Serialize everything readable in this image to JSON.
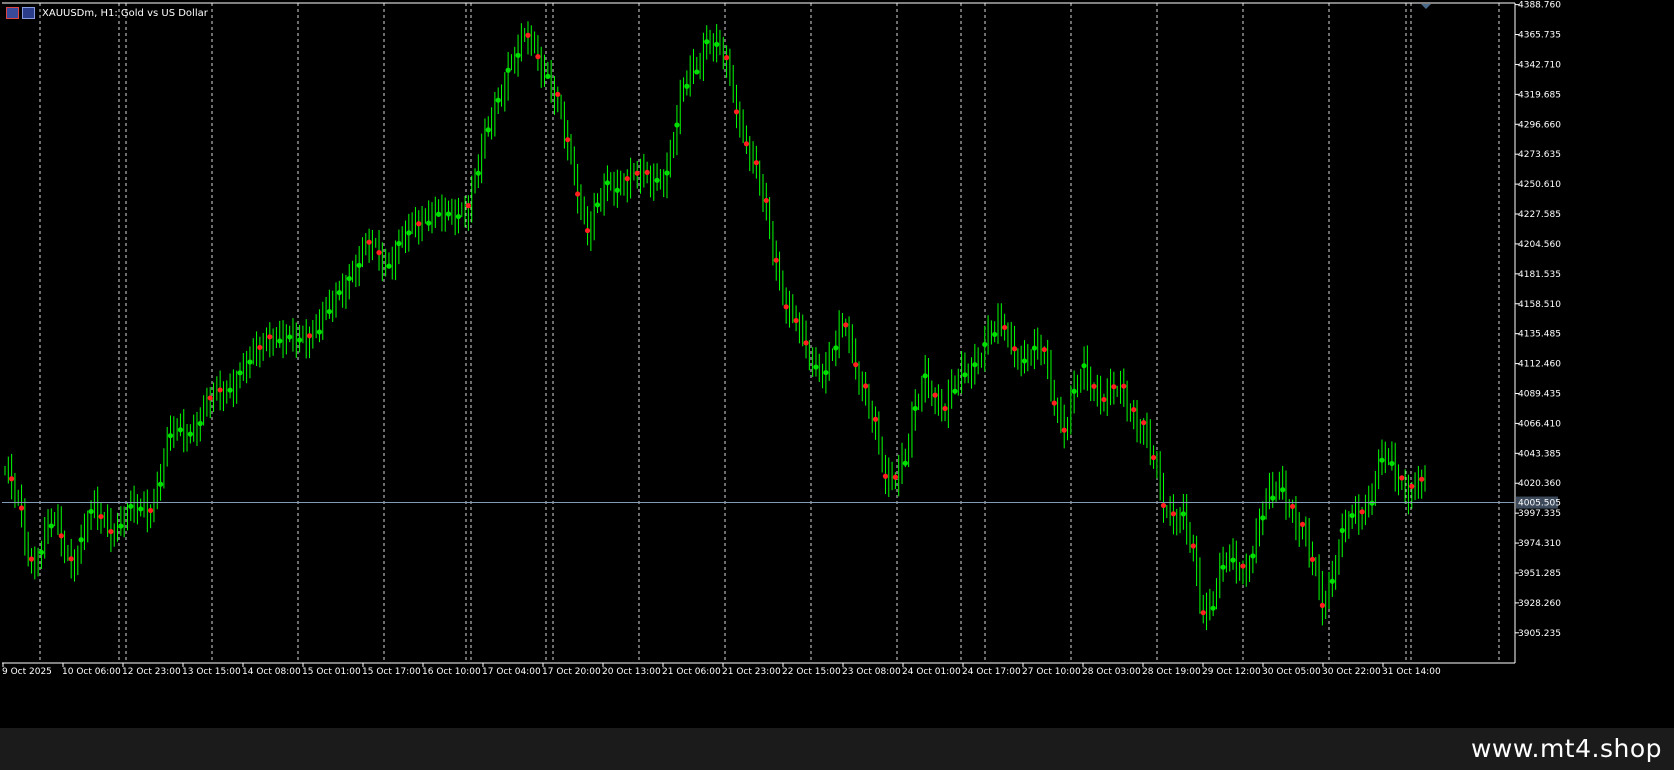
{
  "header": {
    "symbol_title": "XAUUSDm, H1:  Gold vs US Dollar"
  },
  "watermark": "www.mt4.shop",
  "current_price": {
    "label": "4005.505",
    "value": 4005.505
  },
  "colors": {
    "background": "#000000",
    "up_candle": "#00ff00",
    "up_dot": "#00e000",
    "down_dot": "#ff2020",
    "grid_vertical": "#ffffff",
    "axis": "#ffffff",
    "price_line": "#7f9bb8",
    "footer": "#1b1b1b"
  },
  "chart_data": {
    "type": "line",
    "title": "XAUUSDm, H1:  Gold vs US Dollar",
    "xlabel": "",
    "ylabel": "",
    "ylim": [
      3882,
      4390
    ],
    "y_ticks": [
      "4388.760",
      "4365.735",
      "4342.710",
      "4319.685",
      "4296.660",
      "4273.635",
      "4250.610",
      "4227.585",
      "4204.560",
      "4181.535",
      "4158.510",
      "4135.485",
      "4112.460",
      "4089.435",
      "4066.410",
      "4043.385",
      "4020.360",
      "3997.335",
      "3974.310",
      "3951.285",
      "3928.260",
      "3905.235"
    ],
    "x_ticks": [
      "9 Oct 2025",
      "10 Oct 06:00",
      "12 Oct 23:00",
      "13 Oct 15:00",
      "14 Oct 08:00",
      "15 Oct 01:00",
      "15 Oct 17:00",
      "16 Oct 10:00",
      "17 Oct 04:00",
      "17 Oct 20:00",
      "20 Oct 13:00",
      "21 Oct 06:00",
      "21 Oct 23:00",
      "22 Oct 15:00",
      "23 Oct 08:00",
      "24 Oct 01:00",
      "24 Oct 17:00",
      "27 Oct 10:00",
      "28 Oct 03:00",
      "28 Oct 19:00",
      "29 Oct 12:00",
      "30 Oct 05:00",
      "30 Oct 22:00",
      "31 Oct 14:00"
    ],
    "grid": "vertical dashed",
    "series": [
      {
        "x_index": [
          0,
          4,
          8,
          14,
          20,
          26,
          32,
          38,
          44,
          50,
          56,
          62,
          68,
          74,
          80,
          86,
          92,
          98,
          104,
          110,
          116,
          122,
          128,
          134,
          140,
          146,
          152,
          158,
          164,
          170,
          176,
          182,
          188,
          194,
          200,
          206,
          212,
          218,
          224,
          230,
          236,
          242,
          248,
          254,
          260,
          266,
          272,
          278,
          284,
          290,
          296,
          302,
          308,
          314,
          320,
          326,
          332,
          338,
          344,
          350,
          356,
          362,
          368,
          374,
          380,
          386,
          392,
          398,
          404,
          410,
          416,
          422
        ],
        "values": [
          4030,
          4000,
          3960,
          3990,
          3962,
          3995,
          3990,
          3995,
          4005,
          4055,
          4065,
          4080,
          4100,
          4110,
          4140,
          4125,
          4140,
          4150,
          4185,
          4200,
          4195,
          4210,
          4235,
          4220,
          4240,
          4290,
          4345,
          4360,
          4340,
          4275,
          4220,
          4245,
          4260,
          4250,
          4265,
          4330,
          4365,
          4340,
          4285,
          4225,
          4160,
          4120,
          4110,
          4140,
          4090,
          4020,
          4045,
          4100,
          4080,
          4105,
          4130,
          4140,
          4115,
          4120,
          4060,
          4110,
          4085,
          4090,
          4060,
          4005,
          3995,
          3920,
          3960,
          3950,
          4000,
          4020,
          3980,
          3930,
          3980,
          4000,
          4040,
          4020,
          4000,
          4010
        ]
      }
    ]
  }
}
